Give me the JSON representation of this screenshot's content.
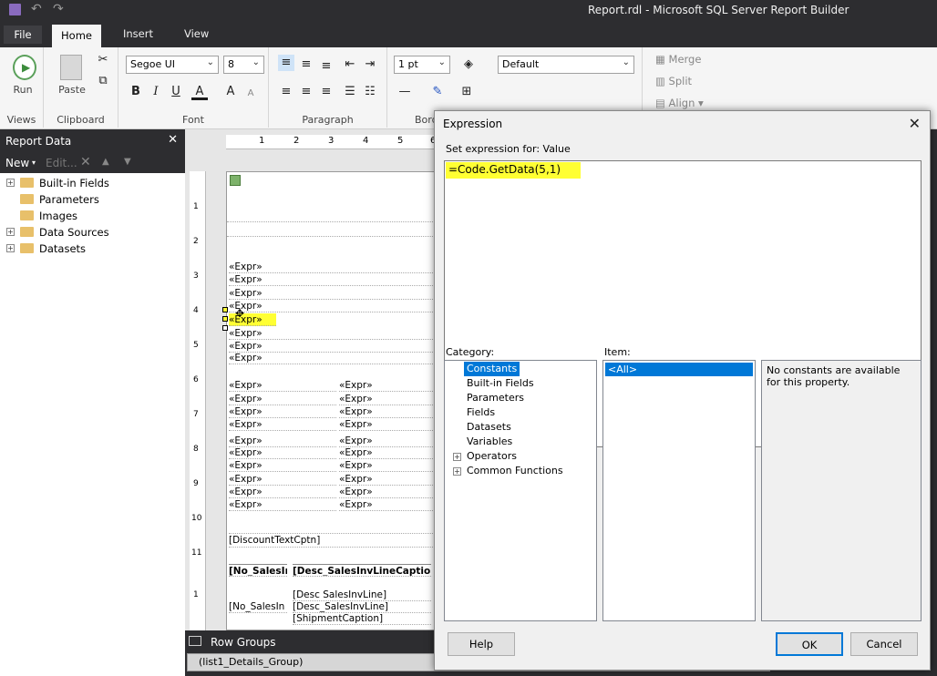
{
  "window": {
    "title": "Report.rdl - Microsoft SQL Server Report Builder"
  },
  "tabs": [
    "File",
    "Home",
    "Insert",
    "View"
  ],
  "ribbon": {
    "views": {
      "run": "Run",
      "label": "Views"
    },
    "clipboard": {
      "paste": "Paste",
      "label": "Clipboard"
    },
    "font": {
      "family": "Segoe UI",
      "size": "8",
      "label": "Font"
    },
    "paragraph": {
      "label": "Paragraph"
    },
    "border": {
      "width": "1 pt",
      "label": "Bord"
    },
    "number": {
      "format": "Default"
    },
    "layout": {
      "merge": "Merge",
      "split": "Split",
      "align": "Align"
    }
  },
  "report_data": {
    "title": "Report Data",
    "toolbar": {
      "new": "New",
      "edit": "Edit..."
    },
    "items": [
      "Built-in Fields",
      "Parameters",
      "Images",
      "Data Sources",
      "Datasets"
    ]
  },
  "ruler": {
    "top": [
      "1",
      "2",
      "3",
      "4",
      "5",
      "6"
    ],
    "left": [
      "1",
      "2",
      "3",
      "4",
      "5",
      "6",
      "7",
      "8",
      "9",
      "10",
      "11",
      "1"
    ]
  },
  "report": {
    "expr": "«Expr»",
    "discount": "[DiscountTextCptn]",
    "header1": "[No_SalesIr",
    "header2": "[Desc_SalesInvLineCaption",
    "desc1": "[Desc SalesInvLine]",
    "desc2": "[Desc_SalesInvLine]",
    "no": "[No_SalesIn",
    "shipment": "[ShipmentCaption]"
  },
  "row_groups": {
    "label": "Row Groups",
    "group": "(list1_Details_Group)"
  },
  "dialog": {
    "title": "Expression",
    "set_for": "Set expression for: Value",
    "expression": "=Code.GetData(5,1)",
    "category_label": "Category:",
    "item_label": "Item:",
    "categories": [
      "Constants",
      "Built-in Fields",
      "Parameters",
      "Fields",
      "Datasets",
      "Variables",
      "Operators",
      "Common Functions"
    ],
    "item": "<All>",
    "description": "No constants are available for this property.",
    "buttons": {
      "help": "Help",
      "ok": "OK",
      "cancel": "Cancel"
    }
  },
  "colors": {
    "highlight": "#ffff33",
    "chrome": "#2d2d30",
    "selection": "#0078d7"
  }
}
